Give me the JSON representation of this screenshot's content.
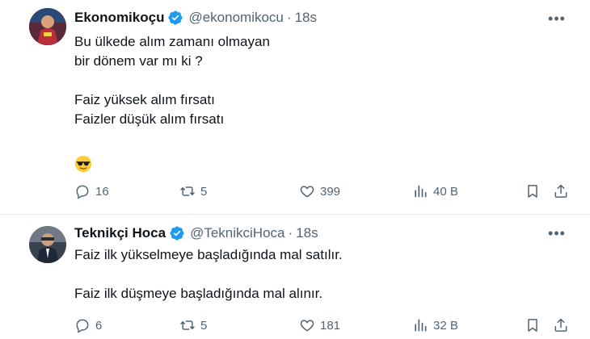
{
  "tweets": [
    {
      "name": "Ekonomikoçu",
      "handle": "@ekonomikocu",
      "separator": "·",
      "time": "18s",
      "lines": [
        "Bu ülkede alım zamanı olmayan",
        "bir dönem var mı ki ?",
        "",
        "Faiz yüksek alım fırsatı",
        "Faizler düşük alım fırsatı"
      ],
      "emoji": "sunglasses-emoji",
      "replies": "16",
      "retweets": "5",
      "likes": "399",
      "views": "40 B"
    },
    {
      "name": "Teknikçi Hoca",
      "handle": "@TeknikciHoca",
      "separator": "·",
      "time": "18s",
      "lines": [
        "Faiz ilk yükselmeye başladığında mal satılır.",
        "",
        "Faiz ilk düşmeye başladığında mal alınır."
      ],
      "replies": "6",
      "retweets": "5",
      "likes": "181",
      "views": "32 B"
    }
  ],
  "colors": {
    "verified": "#1d9bf0",
    "secondary": "#536471",
    "text": "#0f1419",
    "divider": "#e7e9ea"
  },
  "icons": {
    "more": "•••",
    "reply": "reply-icon",
    "retweet": "retweet-icon",
    "like": "heart-icon",
    "views": "views-icon",
    "bookmark": "bookmark-icon",
    "share": "share-icon"
  }
}
